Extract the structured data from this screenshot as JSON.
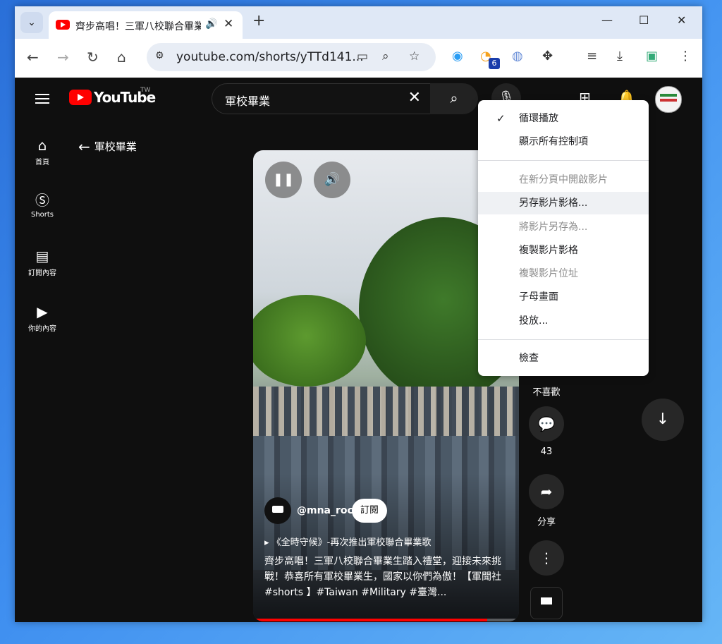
{
  "browser": {
    "tab_title": "齊步高唱！三軍八校聯合畢業生踏入禮堂",
    "address": "youtube.com/shorts/yTTd141...",
    "extension_badge": "6"
  },
  "youtube": {
    "logo_text": "YouTube",
    "country_code": "TW",
    "search_query": "軍校畢業",
    "back_label": "軍校畢業",
    "sidebar": [
      {
        "label": "首頁",
        "icon": "home-icon"
      },
      {
        "label": "Shorts",
        "icon": "shorts-icon"
      },
      {
        "label": "訂閱內容",
        "icon": "subscriptions-icon"
      },
      {
        "label": "你的內容",
        "icon": "library-icon"
      }
    ],
    "short": {
      "channel": "@mna_roc",
      "subscribe_label": "訂閱",
      "song": "《全時守候》-再次推出軍校聯合畢業歌",
      "description": "齊步高唱！三軍八校聯合畢業生踏入禮堂，迎接未來挑戰！恭喜所有軍校畢業生，國家以你們為傲！【軍聞社 #shorts 】#Taiwan #Military #臺灣...",
      "progress": 0.88
    },
    "actions": {
      "dislike_label": "不喜歡",
      "comments_count": "43",
      "share_label": "分享"
    }
  },
  "context_menu": {
    "items": [
      {
        "label": "循環播放",
        "checked": true,
        "disabled": false
      },
      {
        "label": "顯示所有控制項",
        "checked": false,
        "disabled": false
      },
      {
        "label": "在新分頁中開啟影片",
        "checked": false,
        "disabled": true
      },
      {
        "label": "另存影片影格...",
        "checked": false,
        "disabled": false,
        "highlighted": true
      },
      {
        "label": "將影片另存為...",
        "checked": false,
        "disabled": true
      },
      {
        "label": "複製影片影格",
        "checked": false,
        "disabled": false
      },
      {
        "label": "複製影片位址",
        "checked": false,
        "disabled": true
      },
      {
        "label": "子母畫面",
        "checked": false,
        "disabled": false
      },
      {
        "label": "投放...",
        "checked": false,
        "disabled": false
      },
      {
        "label": "檢查",
        "checked": false,
        "disabled": false
      }
    ]
  }
}
